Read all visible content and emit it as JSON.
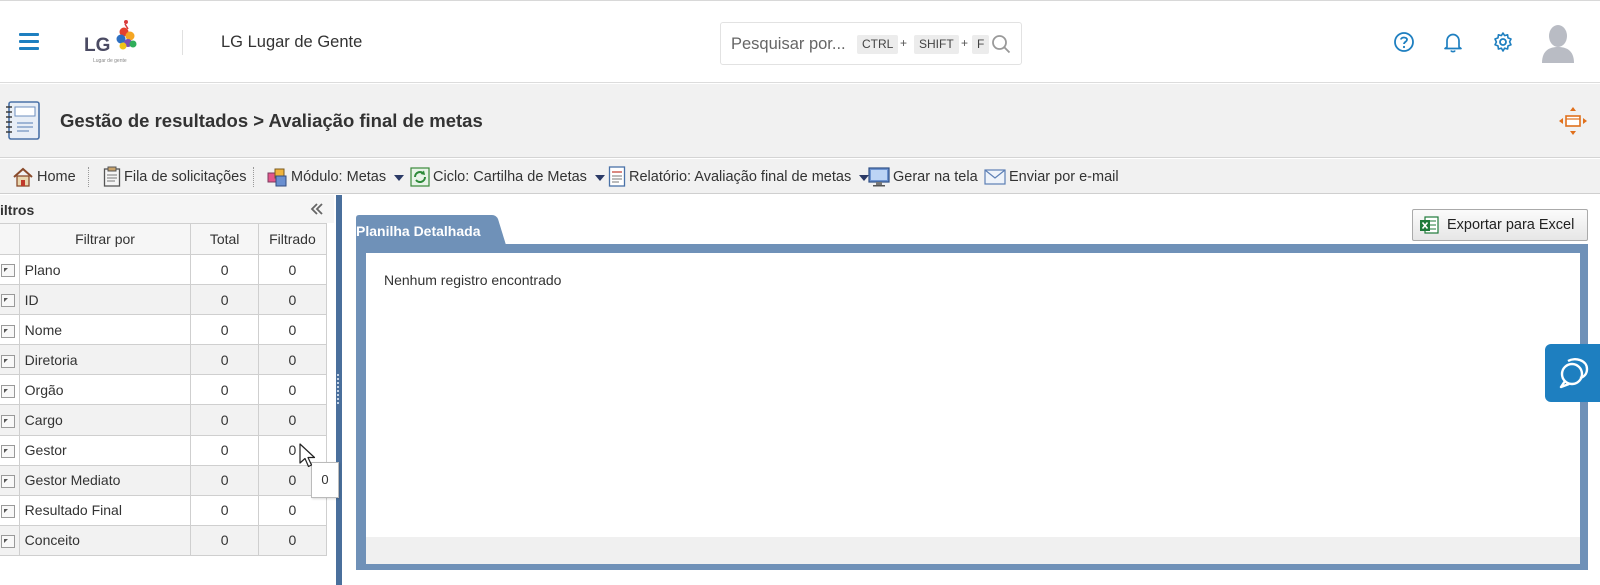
{
  "header": {
    "app_title": "LG Lugar de Gente",
    "logo_text": "LG",
    "logo_subtext": "Lugar de gente",
    "search": {
      "placeholder": "Pesquisar por...",
      "shortcut_keys": [
        "CTRL",
        "SHIFT",
        "F"
      ],
      "separator": "+"
    },
    "icons": [
      "menu-icon",
      "help-icon",
      "bell-icon",
      "gear-icon",
      "avatar"
    ]
  },
  "page": {
    "title": "Gestão de resultados > Avaliação final de metas"
  },
  "toolbar": {
    "home": "Home",
    "queue": "Fila de solicitações",
    "module": "Módulo: Metas",
    "cycle": "Ciclo: Cartilha de Metas",
    "report": "Relatório: Avaliação final de metas",
    "generate": "Gerar na tela",
    "email": "Enviar por e-mail"
  },
  "filters": {
    "title": "iltros",
    "columns": {
      "filter_by": "Filtrar por",
      "total": "Total",
      "filtered": "Filtrado"
    },
    "rows": [
      {
        "name": "Plano",
        "total": "0",
        "filtered": "0"
      },
      {
        "name": "ID",
        "total": "0",
        "filtered": "0"
      },
      {
        "name": "Nome",
        "total": "0",
        "filtered": "0"
      },
      {
        "name": "Diretoria",
        "total": "0",
        "filtered": "0"
      },
      {
        "name": "Orgão",
        "total": "0",
        "filtered": "0"
      },
      {
        "name": "Cargo",
        "total": "0",
        "filtered": "0"
      },
      {
        "name": "Gestor",
        "total": "0",
        "filtered": "0"
      },
      {
        "name": "Gestor Mediato",
        "total": "0",
        "filtered": "0"
      },
      {
        "name": "Resultado Final",
        "total": "0",
        "filtered": "0"
      },
      {
        "name": "Conceito",
        "total": "0",
        "filtered": "0"
      }
    ],
    "tooltip": "0"
  },
  "content": {
    "tab_label": "Planilha Detalhada",
    "export_label": "Exportar para Excel",
    "empty_message": "Nenhum registro encontrado"
  },
  "colors": {
    "accent": "#1e7fc0",
    "panel_frame": "#6f91b8",
    "splitter": "#4a6f9c"
  }
}
